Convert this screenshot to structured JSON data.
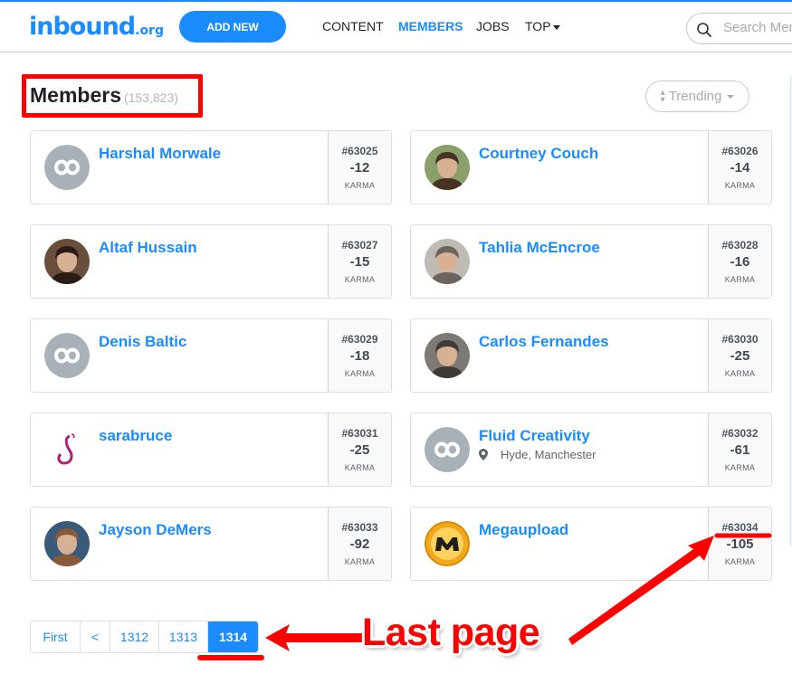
{
  "header": {
    "logo_main": "inbound",
    "logo_suffix": ".org",
    "add_new_label": "ADD NEW",
    "nav": [
      {
        "label": "CONTENT",
        "active": false
      },
      {
        "label": "MEMBERS",
        "active": true
      },
      {
        "label": "JOBS",
        "active": false
      },
      {
        "label": "TOP",
        "active": false,
        "has_dropdown": true
      }
    ],
    "search_placeholder": "Search Members",
    "search_icon": "search-icon"
  },
  "page": {
    "title": "Members",
    "count": "(153,823)",
    "sort_label": "Trending",
    "sort_icon": "sort-updown-icon"
  },
  "members": [
    {
      "name": "Harshal Morwale",
      "rank": "#63025",
      "karma": "-12",
      "karma_label": "KARMA",
      "avatar": "default-infinity-avatar",
      "location": ""
    },
    {
      "name": "Courtney Couch",
      "rank": "#63026",
      "karma": "-14",
      "karma_label": "KARMA",
      "avatar": "photo-avatar",
      "location": ""
    },
    {
      "name": "Altaf Hussain",
      "rank": "#63027",
      "karma": "-15",
      "karma_label": "KARMA",
      "avatar": "photo-avatar",
      "location": ""
    },
    {
      "name": "Tahlia McEncroe",
      "rank": "#63028",
      "karma": "-16",
      "karma_label": "KARMA",
      "avatar": "photo-avatar",
      "location": ""
    },
    {
      "name": "Denis Baltic",
      "rank": "#63029",
      "karma": "-18",
      "karma_label": "KARMA",
      "avatar": "default-infinity-avatar",
      "location": ""
    },
    {
      "name": "Carlos Fernandes",
      "rank": "#63030",
      "karma": "-25",
      "karma_label": "KARMA",
      "avatar": "photo-avatar",
      "location": ""
    },
    {
      "name": "sarabruce",
      "rank": "#63031",
      "karma": "-25",
      "karma_label": "KARMA",
      "avatar": "logo-avatar",
      "location": ""
    },
    {
      "name": "Fluid Creativity",
      "rank": "#63032",
      "karma": "-61",
      "karma_label": "KARMA",
      "avatar": "default-infinity-avatar",
      "location": "Hyde, Manchester"
    },
    {
      "name": "Jayson DeMers",
      "rank": "#63033",
      "karma": "-92",
      "karma_label": "KARMA",
      "avatar": "photo-avatar",
      "location": ""
    },
    {
      "name": "Megaupload",
      "rank": "#63034",
      "karma": "-105",
      "karma_label": "KARMA",
      "avatar": "megaupload-logo-avatar",
      "location": ""
    }
  ],
  "pagination": {
    "items": [
      {
        "label": "First",
        "current": false
      },
      {
        "label": "<",
        "current": false
      },
      {
        "label": "1312",
        "current": false
      },
      {
        "label": "1313",
        "current": false
      },
      {
        "label": "1314",
        "current": true
      }
    ]
  },
  "annotation": {
    "label": "Last page",
    "color": "#ff0000"
  },
  "colors": {
    "accent": "#1a8cff",
    "annotation": "#ff0000",
    "text_dark": "#1e2228",
    "muted": "#a6abb0"
  }
}
